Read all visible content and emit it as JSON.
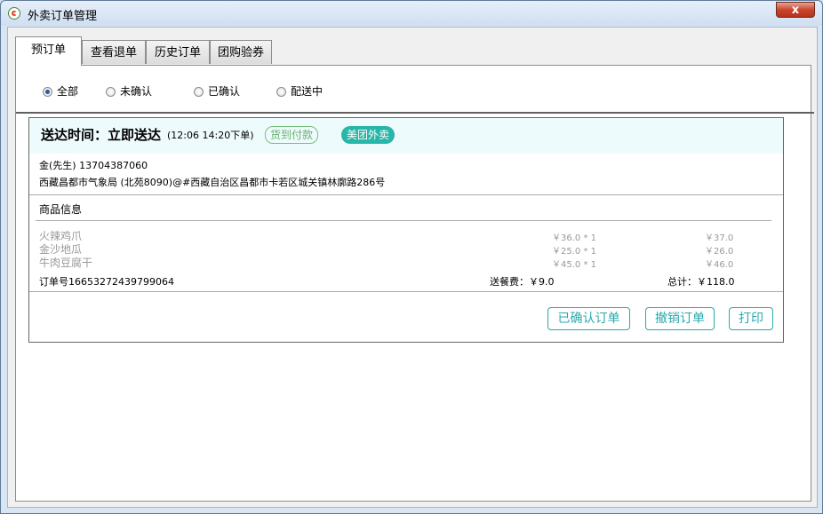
{
  "window": {
    "title": "外卖订单管理",
    "close_label": "x"
  },
  "tabs": [
    {
      "label": "预订单",
      "active": true
    },
    {
      "label": "查看退单",
      "active": false
    },
    {
      "label": "历史订单",
      "active": false
    },
    {
      "label": "团购验券",
      "active": false
    }
  ],
  "filters": [
    {
      "label": "全部",
      "checked": true
    },
    {
      "label": "未确认",
      "checked": false
    },
    {
      "label": "已确认",
      "checked": false
    },
    {
      "label": "配送中",
      "checked": false
    }
  ],
  "order": {
    "title": "送达时间：立即送达",
    "time_note": "(12:06 14:20下单)",
    "payment_badge": "货到付款",
    "platform_badge": "美团外卖",
    "customer": "金(先生) 13704387060",
    "address": "西藏昌都市气象局 (北苑8090)@#西藏自治区昌都市卡若区城关镇林廓路286号",
    "section_title": "商品信息",
    "items": [
      {
        "name": "火辣鸡爪",
        "price_qty": "￥36.0 * 1",
        "total": "￥37.0"
      },
      {
        "name": "金沙地瓜",
        "price_qty": "￥25.0 * 1",
        "total": "￥26.0"
      },
      {
        "name": "牛肉豆腐干",
        "price_qty": "￥45.0 * 1",
        "total": "￥46.0"
      }
    ],
    "order_no": "订单号16653272439799064",
    "delivery_fee": "送餐费：￥9.0",
    "total": "总计：￥118.0",
    "buttons": {
      "confirmed": "已确认订单",
      "cancel": "撤销订单",
      "print": "打印"
    }
  },
  "colors": {
    "accent": "#2aa8ad",
    "platform_badge": "#27b6a8",
    "pay_badge": "#66b06a",
    "header_bg": "#eefbfc"
  }
}
